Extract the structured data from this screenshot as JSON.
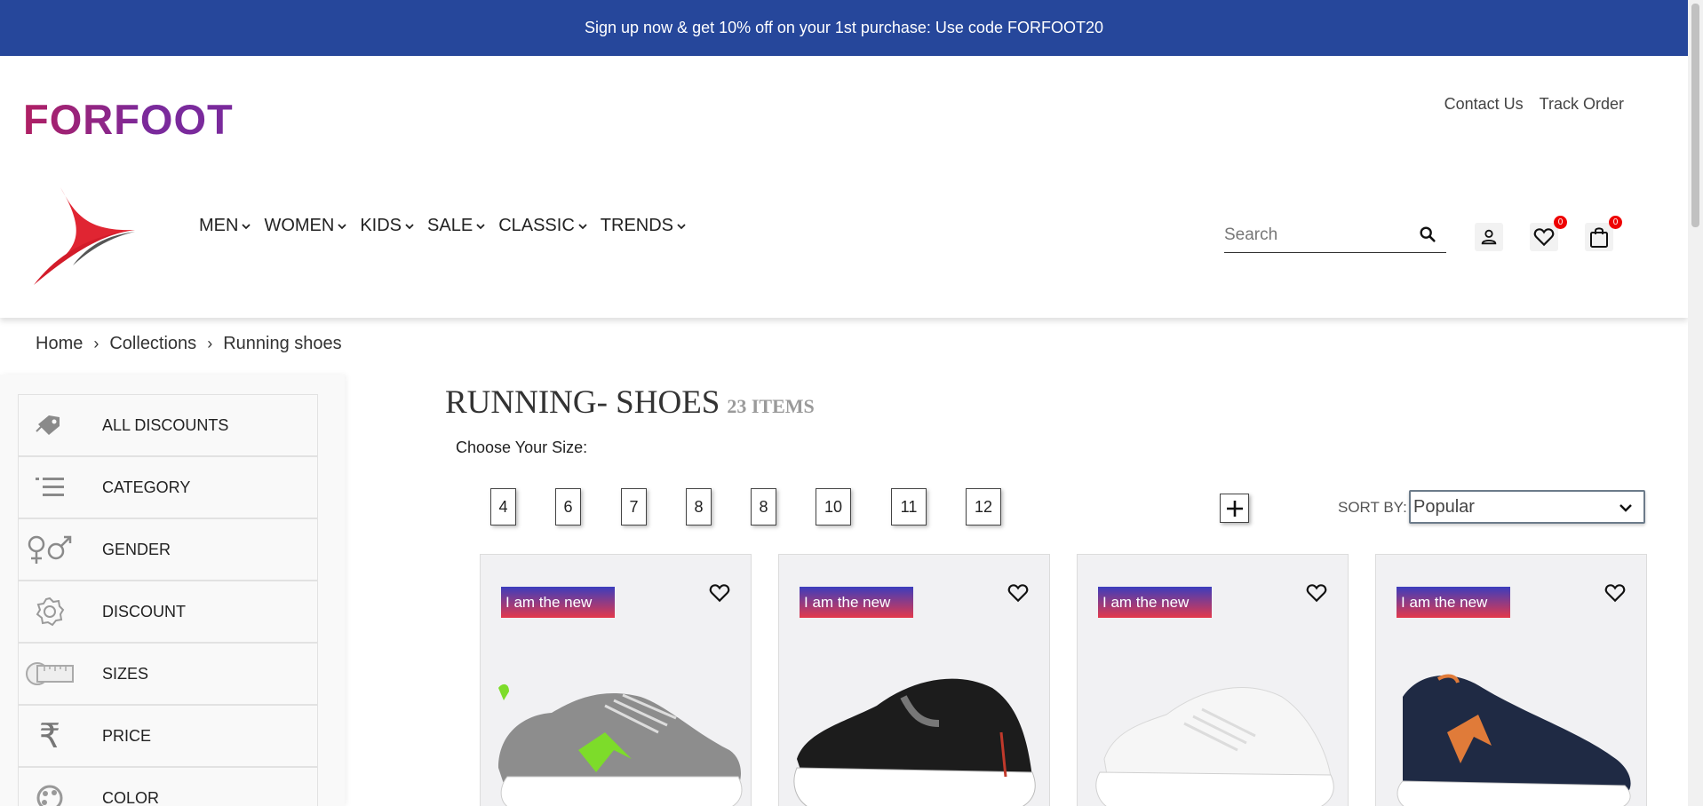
{
  "promo": {
    "text": "Sign up now & get 10% off on your 1st purchase: Use code FORFOOT20"
  },
  "brand": {
    "wordmark": "FORFOOT"
  },
  "top_links": {
    "contact": "Contact Us",
    "track": "Track Order"
  },
  "nav": [
    {
      "label": "MEN"
    },
    {
      "label": "WOMEN"
    },
    {
      "label": "KIDS"
    },
    {
      "label": "SALE"
    },
    {
      "label": "CLASSIC"
    },
    {
      "label": "TRENDS"
    }
  ],
  "search": {
    "placeholder": "Search",
    "value": ""
  },
  "wishlist": {
    "count": "0"
  },
  "cart": {
    "count": "0"
  },
  "breadcrumb": {
    "home": "Home",
    "collections": "Collections",
    "current": "Running shoes"
  },
  "sidebar": {
    "filters": [
      {
        "label": "ALL DISCOUNTS",
        "icon": "tag-icon"
      },
      {
        "label": "CATEGORY",
        "icon": "list-icon"
      },
      {
        "label": "GENDER",
        "icon": "gender-icon"
      },
      {
        "label": "DISCOUNT",
        "icon": "discount-badge-icon"
      },
      {
        "label": "SIZES",
        "icon": "measuring-tape-icon"
      },
      {
        "label": "PRICE",
        "icon": "rupee-icon"
      },
      {
        "label": "COLOR",
        "icon": "palette-icon"
      }
    ]
  },
  "listing": {
    "title": "RUNNING- SHOES",
    "count": "23 ITEMS",
    "choose_size": "Choose Your Size:",
    "sizes": [
      "4",
      "6",
      "7",
      "8",
      "8",
      "10",
      "11",
      "12"
    ],
    "sort_label": "SORT BY:",
    "sort_value": "Popular"
  },
  "products": [
    {
      "tag": "I am the new",
      "shoe_color": "#8d8d8d",
      "accent": "#7ddc2a"
    },
    {
      "tag": "I am the new",
      "shoe_color": "#1c1c1c",
      "accent": "#c0392b"
    },
    {
      "tag": "I am the new",
      "shoe_color": "#f5f5f5",
      "accent": "#dddddd"
    },
    {
      "tag": "I am the new",
      "shoe_color": "#1f2a44",
      "accent": "#e07b39"
    }
  ],
  "colors": {
    "promo_bg": "#26479b",
    "tag_top": "#3b3dbd",
    "tag_bottom": "#e4394b",
    "badge": "#ee0000"
  }
}
